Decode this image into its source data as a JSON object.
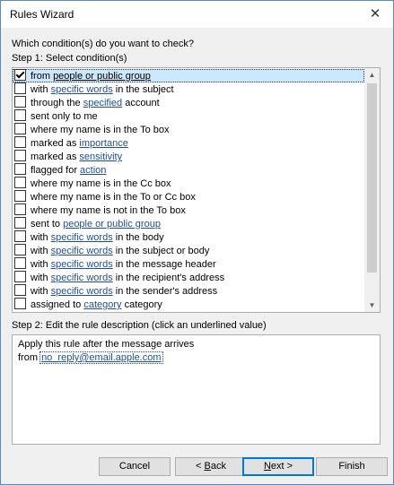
{
  "window": {
    "title": "Rules Wizard",
    "close_glyph": "✕"
  },
  "question": "Which condition(s) do you want to check?",
  "step1_label": "Step 1: Select condition(s)",
  "conditions": [
    {
      "checked": true,
      "selected": true,
      "pre": "from ",
      "link": "people or public group",
      "post": ""
    },
    {
      "checked": false,
      "selected": false,
      "pre": "with ",
      "link": "specific words",
      "post": " in the subject"
    },
    {
      "checked": false,
      "selected": false,
      "pre": "through the ",
      "link": "specified",
      "post": " account"
    },
    {
      "checked": false,
      "selected": false,
      "pre": "sent only to me",
      "link": "",
      "post": ""
    },
    {
      "checked": false,
      "selected": false,
      "pre": "where my name is in the To box",
      "link": "",
      "post": ""
    },
    {
      "checked": false,
      "selected": false,
      "pre": "marked as ",
      "link": "importance",
      "post": ""
    },
    {
      "checked": false,
      "selected": false,
      "pre": "marked as ",
      "link": "sensitivity",
      "post": ""
    },
    {
      "checked": false,
      "selected": false,
      "pre": "flagged for ",
      "link": "action",
      "post": ""
    },
    {
      "checked": false,
      "selected": false,
      "pre": "where my name is in the Cc box",
      "link": "",
      "post": ""
    },
    {
      "checked": false,
      "selected": false,
      "pre": "where my name is in the To or Cc box",
      "link": "",
      "post": ""
    },
    {
      "checked": false,
      "selected": false,
      "pre": "where my name is not in the To box",
      "link": "",
      "post": ""
    },
    {
      "checked": false,
      "selected": false,
      "pre": "sent to ",
      "link": "people or public group",
      "post": ""
    },
    {
      "checked": false,
      "selected": false,
      "pre": "with ",
      "link": "specific words",
      "post": " in the body"
    },
    {
      "checked": false,
      "selected": false,
      "pre": "with ",
      "link": "specific words",
      "post": " in the subject or body"
    },
    {
      "checked": false,
      "selected": false,
      "pre": "with ",
      "link": "specific words",
      "post": " in the message header"
    },
    {
      "checked": false,
      "selected": false,
      "pre": "with ",
      "link": "specific words",
      "post": " in the recipient's address"
    },
    {
      "checked": false,
      "selected": false,
      "pre": "with ",
      "link": "specific words",
      "post": " in the sender's address"
    },
    {
      "checked": false,
      "selected": false,
      "pre": "assigned to ",
      "link": "category",
      "post": " category"
    }
  ],
  "step2_label": "Step 2: Edit the rule description (click an underlined value)",
  "description": {
    "line1": "Apply this rule after the message arrives",
    "line2_pre": "from ",
    "line2_link": "no_reply@email.apple.com"
  },
  "buttons": {
    "cancel": "Cancel",
    "back_arrow": "< ",
    "back_key": "B",
    "back_rest": "ack",
    "next_key": "N",
    "next_rest": "ext >",
    "finish": "Finish"
  },
  "scroll_glyphs": {
    "up": "▲",
    "down": "▼"
  }
}
